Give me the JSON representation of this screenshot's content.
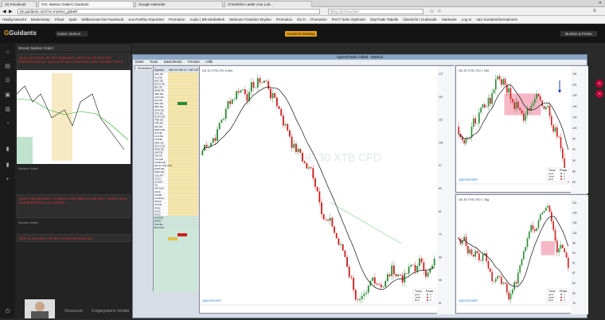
{
  "tabs": [
    "(2) Facebook",
    "GI1: Markus Gabel | Guidants",
    "Google Kalender",
    "Christliche Lieder zum Lob..."
  ],
  "address": "de.guidants.com/?u=markus_gabel#",
  "search_placeholder": "Bing durchsuchen",
  "bookmarks": [
    "Häufig besucht",
    "Bankenstop",
    "Privat",
    "Spiel",
    "Willkommen bei Facebook",
    "Aus Portfoio Importiert",
    "Promotion",
    "Audio | BR-Mediathek",
    "Webcam Frankfurt Skyline",
    "Promotion",
    "Do it! ... Promotion",
    "PACT Selm Optimiert",
    "DayTrade Tabelle",
    "Übersicht | Godmode",
    "Startseite",
    "Log In",
    "1&1 Kundeninformationen"
  ],
  "app": {
    "logo_g": "G",
    "logo_rest": "Guidants",
    "center_button": "Guidants Desktop",
    "right_button": "Buchen & Preise",
    "user": "Gabel, Markus"
  },
  "stream": {
    "title": "Stream Markus Gabel"
  },
  "posts": [
    {
      "text": "Ja so wie heute, als hier angesetzt. Jetzt lese ich noch die Marktinformation, auch wenn das Chart das Leben leichter macht.",
      "meta": "Markus Gabel"
    },
    {
      "text": "Guten Tag allerseits. In diesem Jahr hatte ich die Ehre, unsere neue Handelsfunktion vorzustellen.",
      "meta": "Markus Gabel"
    },
    {
      "text": "Über Community mit dem Zusammenhang gut",
      "meta": "Markus Gabel"
    }
  ],
  "footer_tabs": [
    "Streamset",
    "Freigegebene Inhalte"
  ],
  "window": {
    "title": "AgenaTrader Gabel - Markus",
    "menu": [
      "Datei",
      "Tools",
      "Datenfeeds",
      "Fenster",
      "Hilfe"
    ]
  },
  "toolbar_tabs": [
    "Einrichten",
    "Daytrading",
    "DAX Daytrading",
    "DJI 8h",
    "HW 8h",
    "Swingtrading",
    "Positionen",
    "Trading Journal Manager",
    "Trading Journal Reports"
  ],
  "watchlist": {
    "headers": [
      "Symbol",
      "HW 4h",
      "HW 1h",
      "HW 15m"
    ],
    "symbols": [
      "ADS.DE",
      "ALV.DE",
      "BAS.DE",
      "BAYN.DE",
      "BEI.DE",
      "BMW.DE",
      "CBK.DE",
      "CON.DE",
      "DAI.DE",
      "DB1.DE",
      "DBK.DE",
      "DPW.DE",
      "DTE.DE",
      "EOAN.DE",
      "FME.DE",
      "FRE.DE",
      "HEI.DE",
      "HEN3.DE",
      "IFX.DE",
      "LHA.DE",
      "LIN.DE",
      "MRK.DE",
      "MUV2.DE",
      "RWE.DE",
      "SAP.DE",
      "SIE.DE",
      "TKA.DE",
      "VOW3.DE",
      "DE.30 XTB CFD",
      "EURUSD",
      "GBPUSD",
      "USDJPY",
      "GOLD",
      "SILVER",
      "OIL",
      "NATGAS",
      "US30",
      "US500",
      "USTECH",
      "JP225",
      "UK100",
      "FR40",
      "EU50",
      "HK50",
      "AUS200",
      "BUND",
      "TNOTE",
      "BTCUSD"
    ]
  },
  "charts": [
    {
      "title": "DE.30 XTB CFD 5 Min.",
      "watermark": "DE.30 XTB CFD",
      "brand": "agenatrader",
      "legend_header": [
        "Trend",
        "Phase"
      ],
      "legend_rows": [
        [
          "groß",
          "3"
        ],
        [
          "mittel",
          "3"
        ],
        [
          "klein",
          "3"
        ]
      ]
    },
    {
      "title": "DE.30 XTB CFD 1 Std.",
      "brand": "agenatrader",
      "legend_header": [
        "Trend",
        "Phase"
      ],
      "legend_rows": [
        [
          "groß",
          "2"
        ],
        [
          "mittel",
          "3"
        ],
        [
          "klein",
          "3"
        ]
      ]
    },
    {
      "title": "DE.30 XTB CFD 1 Tag",
      "brand": "agenatrader",
      "legend_header": [
        "Trend",
        "Phase"
      ],
      "legend_rows": [
        [
          "groß",
          "3"
        ],
        [
          "mittel",
          "2"
        ],
        [
          "klein",
          "2"
        ]
      ]
    }
  ],
  "colors": {
    "accent": "#e6a117",
    "bull": "#2e8b3a",
    "bear": "#c22",
    "zone": "#f4a6b8"
  }
}
